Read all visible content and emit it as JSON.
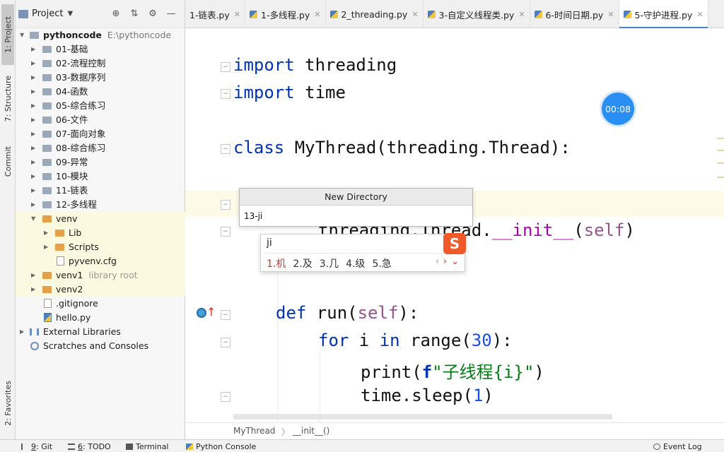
{
  "tool_strip": {
    "project": "1: Project",
    "structure": "7: Structure",
    "commit": "Commit",
    "favorites": "2: Favorites"
  },
  "project_panel": {
    "title": "Project",
    "tree": [
      {
        "label": "pythoncode",
        "extra": "E:\\pythoncode",
        "kind": "root"
      },
      {
        "label": "01-基础",
        "kind": "folder"
      },
      {
        "label": "02-流程控制",
        "kind": "folder"
      },
      {
        "label": "03-数据序列",
        "kind": "folder"
      },
      {
        "label": "04-函数",
        "kind": "folder"
      },
      {
        "label": "05-综合练习",
        "kind": "folder"
      },
      {
        "label": "06-文件",
        "kind": "folder"
      },
      {
        "label": "07-面向对象",
        "kind": "folder"
      },
      {
        "label": "08-综合练习",
        "kind": "folder"
      },
      {
        "label": "09-异常",
        "kind": "folder"
      },
      {
        "label": "10-模块",
        "kind": "folder"
      },
      {
        "label": "11-链表",
        "kind": "folder"
      },
      {
        "label": "12-多线程",
        "kind": "folder"
      },
      {
        "label": "venv",
        "kind": "venv"
      },
      {
        "label": "Lib",
        "kind": "sub"
      },
      {
        "label": "Scripts",
        "kind": "sub"
      },
      {
        "label": "pyvenv.cfg",
        "kind": "subfile"
      },
      {
        "label": "venv1",
        "extra": "library root",
        "kind": "venvc"
      },
      {
        "label": "venv2",
        "kind": "venvc"
      },
      {
        "label": ".gitignore",
        "kind": "file"
      },
      {
        "label": "hello.py",
        "kind": "pyfile"
      },
      {
        "label": "External Libraries",
        "kind": "lib"
      },
      {
        "label": "Scratches and Consoles",
        "kind": "scratch"
      }
    ]
  },
  "tabs": [
    {
      "label": "1-链表.py"
    },
    {
      "label": "1-多线程.py"
    },
    {
      "label": "2_threading.py"
    },
    {
      "label": "3-自定义线程类.py"
    },
    {
      "label": "6-时间日期.py"
    },
    {
      "label": "5-守护进程.py"
    }
  ],
  "editor": {
    "line1": {
      "kw": "import",
      "rest": " threading"
    },
    "line2": {
      "kw": "import",
      "rest": " time"
    },
    "line3": {
      "kw": "class",
      "rest": " MyThread(threading.Thread):"
    },
    "line5": {
      "a": "threading.Thread.",
      "b": "__init__",
      "c": "(",
      "d": "self",
      "e": ")"
    },
    "line6": {
      "kw": "def",
      "a": " run(",
      "b": "self",
      "c": "):"
    },
    "line7": {
      "kw1": "for",
      "a": " i ",
      "kw2": "in",
      "b": " range(",
      "n": "30",
      "c": "):"
    },
    "line8": {
      "a": "print(",
      "f": "f",
      "s": "\"子线程{i}\"",
      "c": ")"
    },
    "line9": {
      "a": "time.sleep(",
      "n": "1",
      "c": ")"
    }
  },
  "timer": "00:08",
  "new_directory": {
    "title": "New Directory",
    "value": "13-ji"
  },
  "ime": {
    "composition": "ji",
    "candidates": [
      "1.机",
      "2.及",
      "3.几",
      "4.级",
      "5.急"
    ],
    "logo": "S"
  },
  "breadcrumb": {
    "class": "MyThread",
    "sep": "〉",
    "method": "__init__()"
  },
  "bottom_bar": {
    "git": {
      "num": "9",
      "label": "Git"
    },
    "todo": {
      "num": "6",
      "label": "TODO"
    },
    "terminal": "Terminal",
    "python_console": "Python Console",
    "event_log": "Event Log"
  }
}
